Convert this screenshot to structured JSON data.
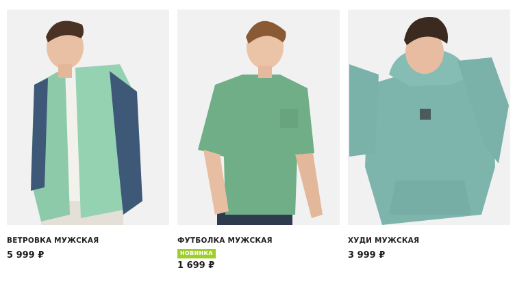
{
  "products": [
    {
      "title": "ВЕТРОВКА МУЖСКАЯ",
      "price": "5 999 ₽",
      "image": "man in mint and navy windbreaker jacket"
    },
    {
      "title": "ФУТБОЛКА МУЖСКАЯ",
      "badge": "НОВИНКА",
      "price": "1 699 ₽",
      "image": "man in green oversized t-shirt"
    },
    {
      "title": "ХУДИ МУЖСКАЯ",
      "price": "3 999 ₽",
      "image": "man in washed teal hoodie"
    }
  ],
  "colors": {
    "badge_bg": "#9fcd2b",
    "photo_bg": "#f1f1f1"
  }
}
